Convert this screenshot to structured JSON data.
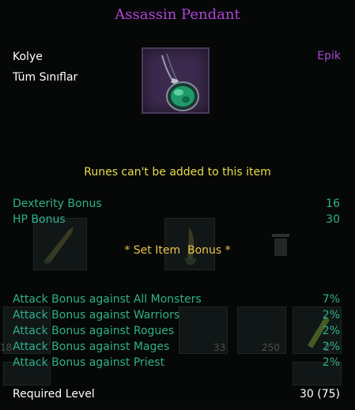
{
  "item": {
    "name": "Assassin Pendant",
    "slot_type": "Kolye",
    "class_restriction": "Tüm Sınıflar",
    "rarity": "Epik",
    "icon": "pendant-icon",
    "rune_notice": "Runes can't be added to this item"
  },
  "bonuses": [
    {
      "label": "Dexterity Bonus",
      "value": "16"
    },
    {
      "label": "HP Bonus",
      "value": "30"
    }
  ],
  "set_item_bonus": "* Set Item  Bonus *",
  "attack_bonuses": [
    {
      "label": "Attack Bonus against All Monsters",
      "value": "7%"
    },
    {
      "label": "Attack Bonus against Warriors",
      "value": "2%"
    },
    {
      "label": "Attack Bonus against Rogues",
      "value": "2%"
    },
    {
      "label": "Attack Bonus against Mages",
      "value": "2%"
    },
    {
      "label": "Attack Bonus against Priest",
      "value": "2%"
    }
  ],
  "required_level": {
    "label": "Required Level",
    "value": "30 (75)"
  },
  "background_inventory": {
    "counts": [
      "18",
      "33",
      "250",
      "2"
    ]
  },
  "colors": {
    "title": "#b245d8",
    "rarity": "#a54ad8",
    "stat_green": "#2fb08a",
    "notice_yellow": "#e8dc4a"
  }
}
